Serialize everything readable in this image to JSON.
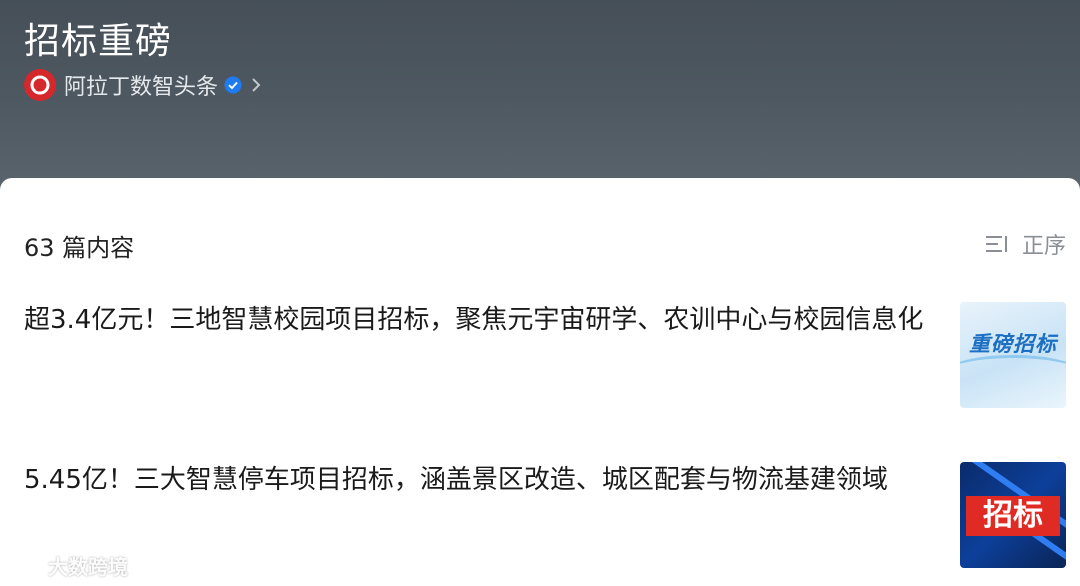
{
  "header": {
    "collection_title": "招标重磅",
    "author_name": "阿拉丁数智头条"
  },
  "content": {
    "count_label": "63 篇内容",
    "sort_label": "正序"
  },
  "articles": [
    {
      "title": "超3.4亿元！三地智慧校园项目招标，聚焦元宇宙研学、农训中心与校园信息化",
      "thumb_text": "重磅招标"
    },
    {
      "title": "5.45亿！三大智慧停车项目招标，涵盖景区改造、城区配套与物流基建领域",
      "thumb_text": "招标"
    }
  ],
  "watermark": {
    "text": "大数跨境"
  },
  "colors": {
    "header_bg": "#4f5962",
    "brand_red": "#d4282d",
    "verified_blue": "#1e7bf2"
  }
}
